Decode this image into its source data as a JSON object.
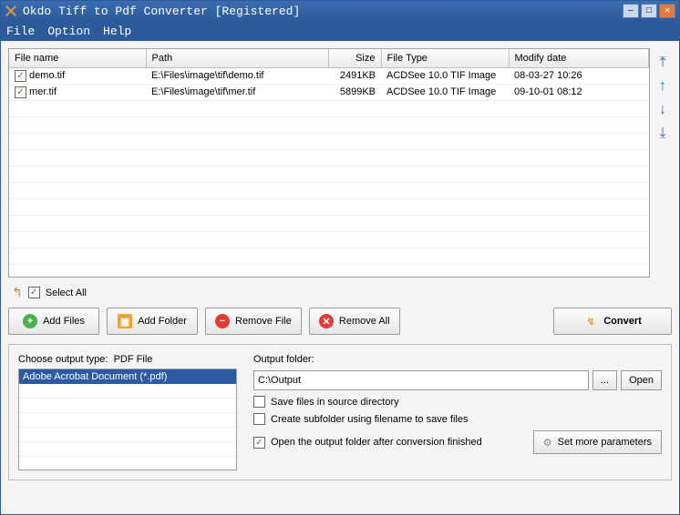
{
  "window": {
    "title": "Okdo Tiff to Pdf Converter [Registered]"
  },
  "menu": {
    "file": "File",
    "option": "Option",
    "help": "Help"
  },
  "table": {
    "headers": {
      "name": "File name",
      "path": "Path",
      "size": "Size",
      "type": "File Type",
      "date": "Modify date"
    },
    "rows": [
      {
        "checked": true,
        "name": "demo.tif",
        "path": "E:\\Files\\image\\tif\\demo.tif",
        "size": "2491KB",
        "type": "ACDSee 10.0 TIF Image",
        "date": "08-03-27 10:26"
      },
      {
        "checked": true,
        "name": "mer.tif",
        "path": "E:\\Files\\image\\tif\\mer.tif",
        "size": "5899KB",
        "type": "ACDSee 10.0 TIF Image",
        "date": "09-10-01 08:12"
      }
    ]
  },
  "selectall": {
    "label": "Select All",
    "checked": true
  },
  "buttons": {
    "addfiles": "Add Files",
    "addfolder": "Add Folder",
    "removefile": "Remove File",
    "removeall": "Remove All",
    "convert": "Convert"
  },
  "output": {
    "choose_label": "Choose output type:",
    "type_value": "PDF File",
    "type_option": "Adobe Acrobat Document (*.pdf)",
    "folder_label": "Output folder:",
    "folder_value": "C:\\Output",
    "browse": "...",
    "open": "Open",
    "save_source": {
      "label": "Save files in source directory",
      "checked": false
    },
    "create_sub": {
      "label": "Create subfolder using filename to save files",
      "checked": false
    },
    "open_after": {
      "label": "Open the output folder after conversion finished",
      "checked": true
    },
    "more": "Set more parameters"
  }
}
